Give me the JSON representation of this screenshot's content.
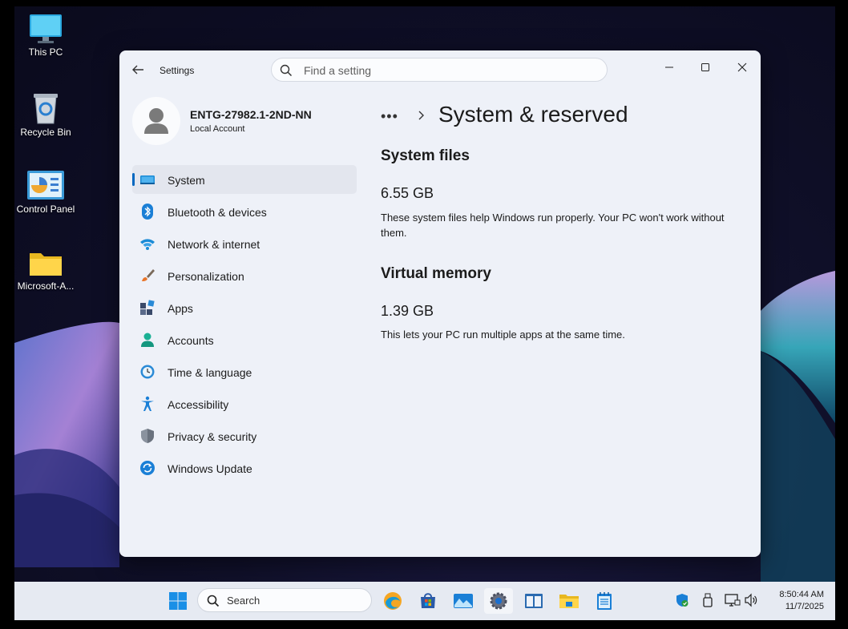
{
  "desktop": {
    "icons": [
      {
        "label": "This PC",
        "icon": "this-pc-icon"
      },
      {
        "label": "Recycle Bin",
        "icon": "recycle-bin-icon"
      },
      {
        "label": "Control Panel",
        "icon": "control-panel-icon"
      },
      {
        "label": "Microsoft-A...",
        "icon": "folder-icon"
      }
    ]
  },
  "window": {
    "app_title": "Settings",
    "search_placeholder": "Find a setting",
    "profile": {
      "name": "ENTG-27982.1-2ND-NN",
      "account_type": "Local Account"
    },
    "nav": [
      {
        "label": "System",
        "icon": "system-icon",
        "active": true
      },
      {
        "label": "Bluetooth & devices",
        "icon": "bluetooth-icon"
      },
      {
        "label": "Network & internet",
        "icon": "wifi-icon"
      },
      {
        "label": "Personalization",
        "icon": "brush-icon"
      },
      {
        "label": "Apps",
        "icon": "apps-icon"
      },
      {
        "label": "Accounts",
        "icon": "accounts-icon"
      },
      {
        "label": "Time & language",
        "icon": "clock-globe-icon"
      },
      {
        "label": "Accessibility",
        "icon": "accessibility-icon"
      },
      {
        "label": "Privacy & security",
        "icon": "shield-icon"
      },
      {
        "label": "Windows Update",
        "icon": "update-icon"
      }
    ],
    "breadcrumb_more": "•••",
    "page_title": "System & reserved",
    "sections": [
      {
        "title": "System files",
        "size": "6.55 GB",
        "description": "These system files help Windows run properly. Your PC won't work without them."
      },
      {
        "title": "Virtual memory",
        "size": "1.39 GB",
        "description": "This lets your PC run multiple apps at the same time."
      }
    ]
  },
  "taskbar": {
    "search_label": "Search",
    "time": "8:50:44 AM",
    "date": "11/7/2025",
    "accent": "#0067c0"
  }
}
